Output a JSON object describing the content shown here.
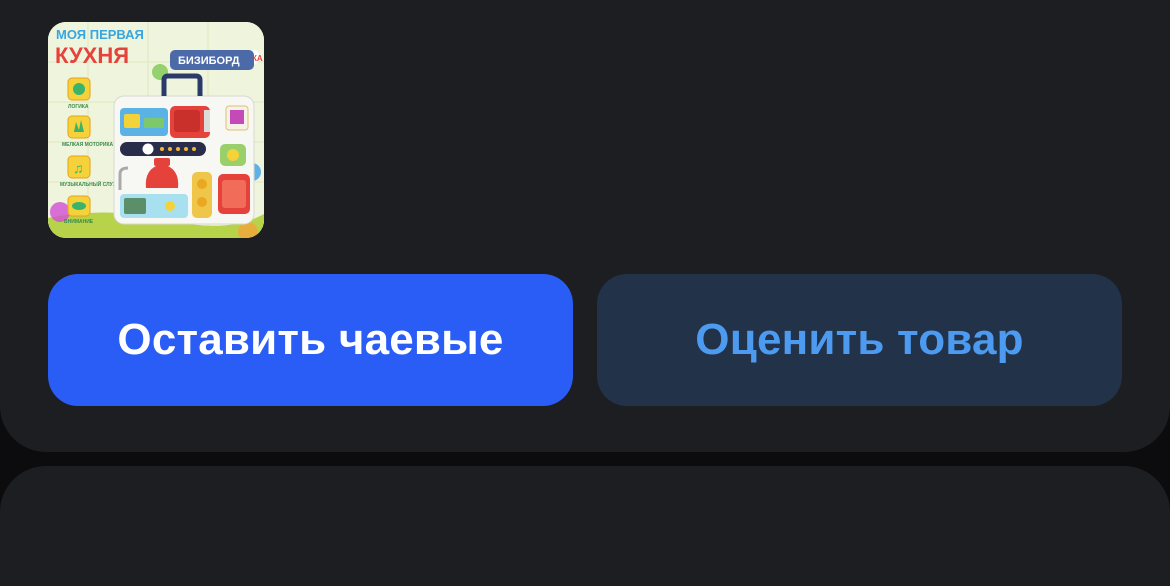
{
  "product": {
    "image": {
      "icon": "busy-board-toy-box-image",
      "box_title_line1": "МОЯ ПЕРВАЯ",
      "box_title_line2": "КУХНЯ",
      "box_badge": "БИЗИБОРД",
      "brand": "ЗАБИЯКА",
      "features": [
        "ЛОГИКА",
        "МЕЛКАЯ МОТОРИКА",
        "МУЗЫКАЛЬНЫЙ СЛУХ",
        "ВНИМАНИЕ"
      ]
    }
  },
  "actions": {
    "tip_label": "Оставить чаевые",
    "rate_label": "Оценить товар"
  },
  "colors": {
    "background": "#0c0c0e",
    "card": "#1d1e22",
    "primary_button": "#2a5cf6",
    "secondary_button": "#223249",
    "secondary_text": "#4d9bf0"
  }
}
